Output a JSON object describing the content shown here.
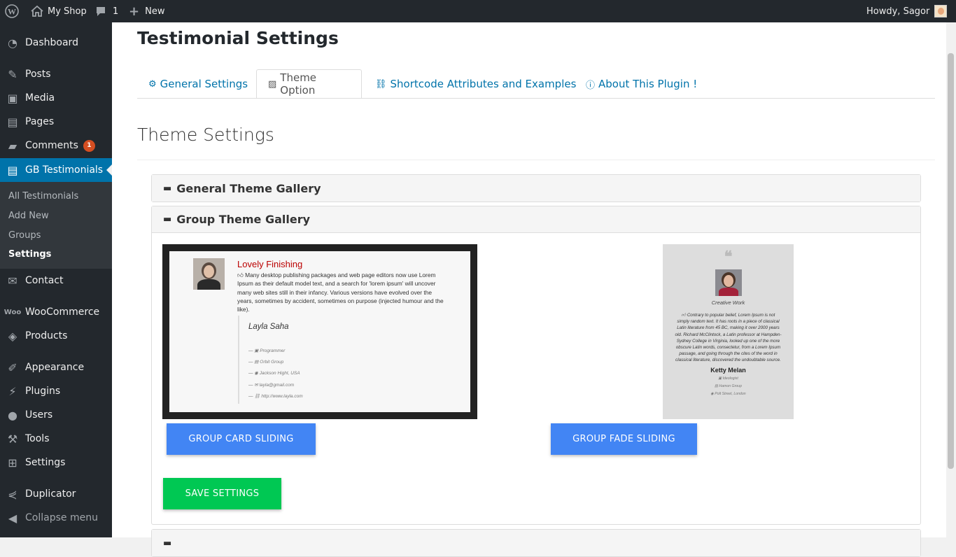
{
  "adminbar": {
    "site_name": "My Shop",
    "comments_count": "1",
    "new_label": "New",
    "howdy": "Howdy, Sagor"
  },
  "sidebar": {
    "items": [
      {
        "label": "Dashboard",
        "icon": "dashboard-icon"
      },
      {
        "label": "Posts",
        "icon": "pin-icon"
      },
      {
        "label": "Media",
        "icon": "media-icon"
      },
      {
        "label": "Pages",
        "icon": "pages-icon"
      },
      {
        "label": "Comments",
        "icon": "comment-icon",
        "badge": "1"
      },
      {
        "label": "GB Testimonials",
        "icon": "testimonial-icon"
      },
      {
        "label": "Contact",
        "icon": "mail-icon"
      },
      {
        "label": "WooCommerce",
        "icon": "woo-icon"
      },
      {
        "label": "Products",
        "icon": "box-icon"
      },
      {
        "label": "Appearance",
        "icon": "brush-icon"
      },
      {
        "label": "Plugins",
        "icon": "plug-icon"
      },
      {
        "label": "Users",
        "icon": "user-icon"
      },
      {
        "label": "Tools",
        "icon": "wrench-icon"
      },
      {
        "label": "Settings",
        "icon": "settings-icon"
      },
      {
        "label": "Duplicator",
        "icon": "share-icon"
      },
      {
        "label": "Collapse menu",
        "icon": "collapse-icon"
      }
    ],
    "submenu": [
      "All Testimonials",
      "Add New",
      "Groups",
      "Settings"
    ]
  },
  "page": {
    "title": "Testimonial Settings",
    "tabs": [
      "General Settings",
      "Theme Option",
      "Shortcode Attributes and Examples",
      "About This Plugin !"
    ],
    "section_title": "Theme Settings"
  },
  "panels": {
    "general": "General Theme Gallery",
    "group": "Group Theme Gallery"
  },
  "preview_card": {
    "title": "Lovely Finishing",
    "body": "Many desktop publishing packages and web page editors now use Lorem Ipsum as their default model text, and a search for 'lorem ipsum' will uncover many web sites still in their infancy. Various versions have evolved over the years, sometimes by accident, sometimes on purpose (injected humour and the like).",
    "name": "Layla Saha",
    "details": [
      "Programmer",
      "Orbit Group",
      "Jackson Hight, USA",
      "layla@gmail.com",
      "http://www.layla.com"
    ]
  },
  "preview_fade": {
    "subtitle": "Creative Work",
    "body": "Contrary to popular belief, Lorem Ipsum is not simply random text. It has roots in a piece of classical Latin literature from 45 BC, making it over 2000 years old. Richard McClintock, a Latin professor at Hampden-Sydney College in Virginia, looked up one of the more obscure Latin words, consectetur, from a Lorem Ipsum passage, and going through the cites of the word in classical literature, discovered the undoubtable source.",
    "name": "Ketty Melan",
    "details": [
      "Ideologist",
      "Hamon Group",
      "Polt Street, London"
    ]
  },
  "buttons": {
    "card_sliding": "GROUP CARD SLIDING",
    "fade_sliding": "GROUP FADE SLIDING",
    "save": "SAVE SETTINGS"
  },
  "colors": {
    "admin_dark": "#23282d",
    "wp_blue": "#0073aa",
    "button_blue": "#4285f4",
    "button_green": "#00c853",
    "badge": "#d54e21"
  }
}
